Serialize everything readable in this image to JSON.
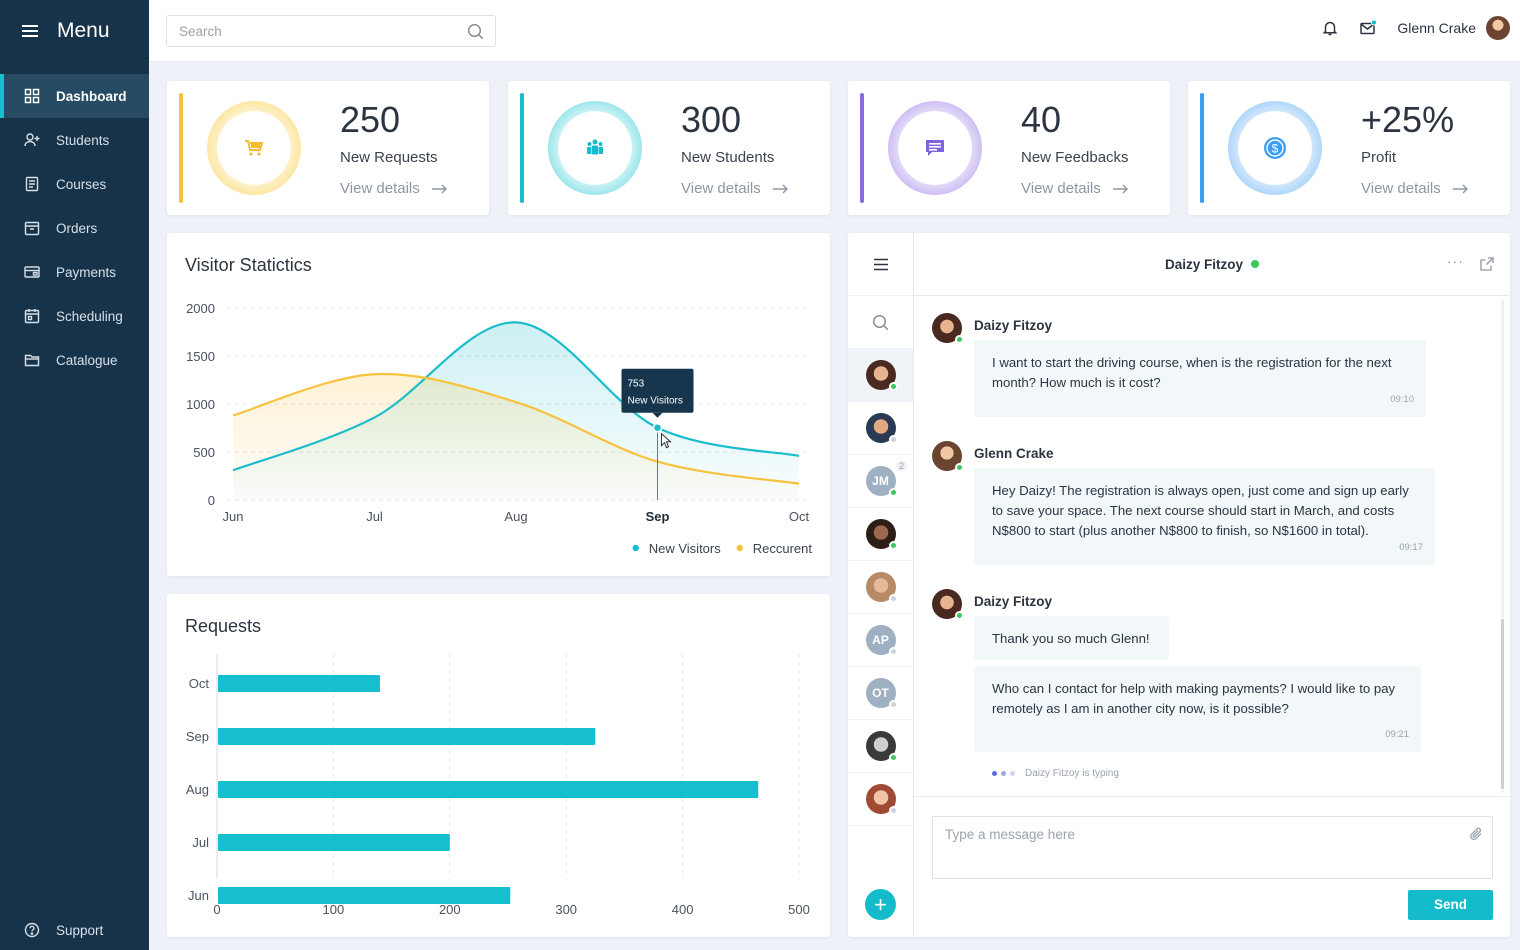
{
  "sidebar": {
    "title": "Menu",
    "items": [
      {
        "label": "Dashboard",
        "icon": "dashboard-icon"
      },
      {
        "label": "Students",
        "icon": "students-icon"
      },
      {
        "label": "Courses",
        "icon": "courses-icon"
      },
      {
        "label": "Orders",
        "icon": "orders-icon"
      },
      {
        "label": "Payments",
        "icon": "payments-icon"
      },
      {
        "label": "Scheduling",
        "icon": "calendar-icon"
      },
      {
        "label": "Catalogue",
        "icon": "folder-icon"
      }
    ],
    "support_label": "Support"
  },
  "topbar": {
    "search_placeholder": "Search",
    "user_name": "Glenn Crake"
  },
  "stats": [
    {
      "value": "250",
      "label": "New Requests",
      "link": "View details",
      "color": "#f7c23e",
      "icon": "cart-icon"
    },
    {
      "value": "300",
      "label": "New Students",
      "link": "View details",
      "color": "#15bfcd",
      "icon": "group-icon"
    },
    {
      "value": "40",
      "label": "New Feedbacks",
      "link": "View details",
      "color": "#8b6ce0",
      "icon": "feedback-icon"
    },
    {
      "value": "+25%",
      "label": "Profit",
      "link": "View details",
      "color": "#3a9ef2",
      "icon": "coin-icon"
    }
  ],
  "visitor_chart": {
    "title": "Visitor Statictics",
    "chart_data": {
      "type": "area",
      "x": [
        "Jun",
        "Jul",
        "Aug",
        "Sep",
        "Oct"
      ],
      "y_ticks": [
        0,
        500,
        1000,
        1500,
        2000
      ],
      "ylim": [
        0,
        2000
      ],
      "series": [
        {
          "name": "New Visitors",
          "color": "#1bbccb",
          "values": [
            310,
            860,
            1850,
            753,
            460
          ]
        },
        {
          "name": "Reccurent",
          "color": "#f7c23e",
          "values": [
            880,
            1310,
            1020,
            400,
            170
          ]
        }
      ],
      "highlight": {
        "x": "Sep",
        "value": "753",
        "label": "New Visitors"
      },
      "grid": true,
      "legend": "bottom-right"
    }
  },
  "requests_chart": {
    "title": "Requests",
    "chart_data": {
      "type": "bar",
      "orientation": "horizontal",
      "categories": [
        "Oct",
        "Sep",
        "Aug",
        "Jul",
        "Jun"
      ],
      "values": [
        140,
        325,
        465,
        200,
        252
      ],
      "x_ticks": [
        0,
        100,
        200,
        300,
        400,
        500
      ],
      "xlim": [
        0,
        500
      ],
      "color": "#15bfcd",
      "grid": true
    }
  },
  "chat": {
    "contact_name": "Daizy Fitzoy",
    "more_label": "···",
    "contacts": [
      {
        "initials": "",
        "status": "on",
        "count": "",
        "skin": "#e8b48f",
        "hair": "#4a2a20"
      },
      {
        "initials": "",
        "status": "off",
        "count": "",
        "skin": "#e2a882",
        "hair": "#2a3a55"
      },
      {
        "initials": "JM",
        "status": "on",
        "count": "2",
        "skin": "",
        "hair": ""
      },
      {
        "initials": "",
        "status": "on",
        "count": "",
        "skin": "#9b6a4d",
        "hair": "#2e1e18"
      },
      {
        "initials": "",
        "status": "off",
        "count": "",
        "skin": "#e6b99a",
        "hair": "#b58a64"
      },
      {
        "initials": "AP",
        "status": "off",
        "count": "",
        "skin": "",
        "hair": ""
      },
      {
        "initials": "OT",
        "status": "off",
        "count": "",
        "skin": "",
        "hair": ""
      },
      {
        "initials": "",
        "status": "on",
        "count": "",
        "skin": "#cfcfcf",
        "hair": "#3a3a3a"
      },
      {
        "initials": "",
        "status": "off",
        "count": "",
        "skin": "#f0c4a4",
        "hair": "#a04a35"
      }
    ],
    "messages": [
      {
        "author": "Daizy Fitzoy",
        "text": "I want to start the driving course, when is the registration for the next month? How much is it cost?",
        "time": "09:10"
      },
      {
        "author": "Glenn Crake",
        "text": "Hey Daizy! The registration is always open, just come and sign up early to save your space. The next course should start in March, and costs N$800 to start (plus another N$800 to finish, so N$1600 in total).",
        "time": "09:17"
      },
      {
        "author": "Daizy Fitzoy",
        "text": "Thank you so much Glenn!",
        "time": ""
      },
      {
        "author": "",
        "text": "Who can I contact for help with making payments? I would like to pay remotely as I am in another city now, is it possible?",
        "time": "09:21"
      }
    ],
    "typing_text": "Daizy Fitzoy is typing",
    "composer_placeholder": "Type a message here",
    "send_label": "Send",
    "add_label": "+"
  }
}
